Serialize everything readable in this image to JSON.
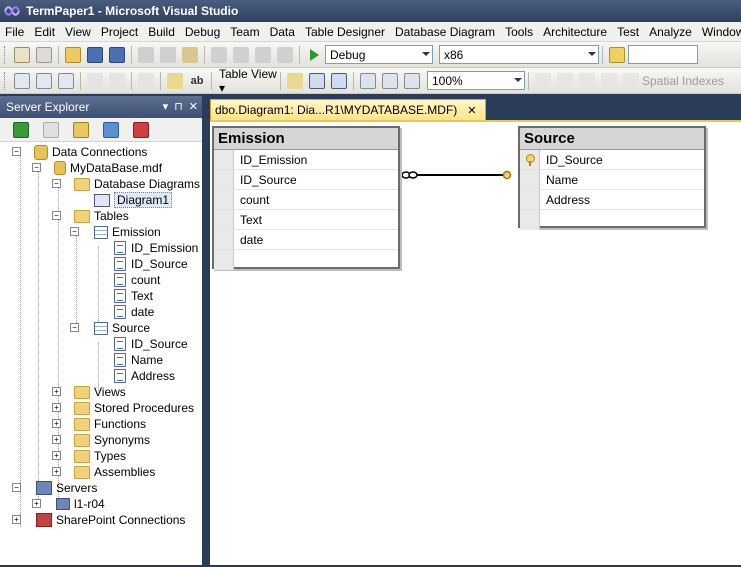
{
  "window": {
    "title": "TermPaper1 - Microsoft Visual Studio"
  },
  "menu": [
    "File",
    "Edit",
    "View",
    "Project",
    "Build",
    "Debug",
    "Team",
    "Data",
    "Table Designer",
    "Database Diagram",
    "Tools",
    "Architecture",
    "Test",
    "Analyze",
    "Window"
  ],
  "toolbar1": {
    "config": "Debug",
    "platform": "x86"
  },
  "toolbar2": {
    "table_view": "Table View ▾",
    "zoom": "100%",
    "spatial": "Spatial Indexes"
  },
  "server_explorer": {
    "title": "Server Explorer",
    "pin": "▾ ⊓ ✕",
    "data_connections": "Data Connections",
    "database": "MyDataBase.mdf",
    "database_diagrams": "Database Diagrams",
    "diagram1": "Diagram1",
    "tables": "Tables",
    "emission": "Emission",
    "emission_cols": [
      "ID_Emission",
      "ID_Source",
      "count",
      "Text",
      "date"
    ],
    "source": "Source",
    "source_cols": [
      "ID_Source",
      "Name",
      "Address"
    ],
    "folders": [
      "Views",
      "Stored Procedures",
      "Functions",
      "Synonyms",
      "Types",
      "Assemblies"
    ],
    "servers": "Servers",
    "server_node": "l1-r04",
    "sharepoint": "SharePoint Connections"
  },
  "document": {
    "tab_label": "dbo.Diagram1: Dia...R1\\MYDATABASE.MDF)",
    "emission_table": {
      "name": "Emission",
      "columns": [
        "ID_Emission",
        "ID_Source",
        "count",
        "Text",
        "date"
      ]
    },
    "source_table": {
      "name": "Source",
      "columns": [
        "ID_Source",
        "Name",
        "Address"
      ]
    }
  }
}
